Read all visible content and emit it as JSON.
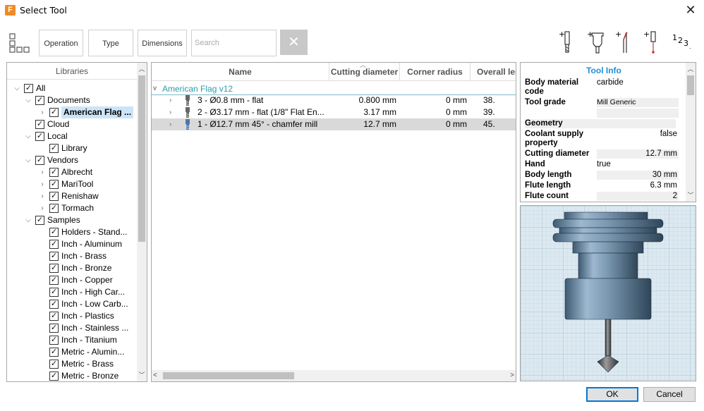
{
  "window": {
    "title": "Select Tool",
    "app_icon_letter": "F"
  },
  "toolbar": {
    "operation_label": "Operation",
    "type_label": "Type",
    "dimensions_label": "Dimensions",
    "search_placeholder": "Search",
    "clear_symbol": "✕",
    "numbering_label": "1 2 3"
  },
  "libraries": {
    "header": "Libraries",
    "items": [
      {
        "label": "All",
        "level": 0,
        "arrow": "v",
        "checked": true
      },
      {
        "label": "Documents",
        "level": 1,
        "arrow": "v",
        "checked": true
      },
      {
        "label": "American Flag ...",
        "level": 2,
        "arrow": ">",
        "checked": true,
        "selected": true
      },
      {
        "label": "Cloud",
        "level": 1,
        "arrow": "",
        "checked": true
      },
      {
        "label": "Local",
        "level": 1,
        "arrow": "v",
        "checked": true
      },
      {
        "label": "Library",
        "level": 2,
        "arrow": "",
        "checked": true
      },
      {
        "label": "Vendors",
        "level": 1,
        "arrow": "v",
        "checked": true
      },
      {
        "label": "Albrecht",
        "level": 2,
        "arrow": ">",
        "checked": true
      },
      {
        "label": "MariTool",
        "level": 2,
        "arrow": ">",
        "checked": true
      },
      {
        "label": "Renishaw",
        "level": 2,
        "arrow": ">",
        "checked": true
      },
      {
        "label": "Tormach",
        "level": 2,
        "arrow": ">",
        "checked": true
      },
      {
        "label": "Samples",
        "level": 1,
        "arrow": "v",
        "checked": true
      },
      {
        "label": "Holders - Stand...",
        "level": 2,
        "arrow": "",
        "checked": true
      },
      {
        "label": "Inch - Aluminum",
        "level": 2,
        "arrow": "",
        "checked": true
      },
      {
        "label": "Inch - Brass",
        "level": 2,
        "arrow": "",
        "checked": true
      },
      {
        "label": "Inch - Bronze",
        "level": 2,
        "arrow": "",
        "checked": true
      },
      {
        "label": "Inch - Copper",
        "level": 2,
        "arrow": "",
        "checked": true
      },
      {
        "label": "Inch - High Car...",
        "level": 2,
        "arrow": "",
        "checked": true
      },
      {
        "label": "Inch - Low Carb...",
        "level": 2,
        "arrow": "",
        "checked": true
      },
      {
        "label": "Inch - Plastics",
        "level": 2,
        "arrow": "",
        "checked": true
      },
      {
        "label": "Inch - Stainless ...",
        "level": 2,
        "arrow": "",
        "checked": true
      },
      {
        "label": "Inch - Titanium",
        "level": 2,
        "arrow": "",
        "checked": true
      },
      {
        "label": "Metric - Alumin...",
        "level": 2,
        "arrow": "",
        "checked": true
      },
      {
        "label": "Metric - Brass",
        "level": 2,
        "arrow": "",
        "checked": true
      },
      {
        "label": "Metric - Bronze",
        "level": 2,
        "arrow": "",
        "checked": true
      }
    ]
  },
  "tool_table": {
    "columns": [
      "Name",
      "Cutting diameter",
      "Corner radius",
      "Overall len"
    ],
    "group_label": "American Flag v12",
    "rows": [
      {
        "name": "3 - Ø0.8 mm - flat",
        "cutting_diameter": "0.800 mm",
        "corner_radius": "0 mm",
        "overall_length": "38.",
        "selected": false
      },
      {
        "name": "2 - Ø3.17 mm - flat (1/8\" Flat En...",
        "cutting_diameter": "3.17 mm",
        "corner_radius": "0 mm",
        "overall_length": "39.",
        "selected": false
      },
      {
        "name": "1 - Ø12.7 mm 45° - chamfer mill",
        "cutting_diameter": "12.7 mm",
        "corner_radius": "0 mm",
        "overall_length": "45.",
        "selected": true
      }
    ]
  },
  "tool_info": {
    "title": "Tool Info",
    "body_material_key": "Body material code",
    "body_material_val": "carbide",
    "tool_grade_key": "Tool grade",
    "tool_grade_val": "Mill Generic",
    "geometry_key": "Geometry",
    "coolant_key": "Coolant supply property",
    "coolant_val": "false",
    "cutting_diameter_key": "Cutting diameter",
    "cutting_diameter_val": "12.7 mm",
    "hand_key": "Hand",
    "hand_val": "true",
    "body_length_key": "Body length",
    "body_length_val": "30 mm",
    "flute_length_key": "Flute length",
    "flute_length_val": "6.3 mm",
    "flute_count_key": "Flute count",
    "flute_count_val": "2"
  },
  "buttons": {
    "ok": "OK",
    "cancel": "Cancel"
  },
  "colors": {
    "accent": "#1f8fd6",
    "group_text": "#2a9bb0",
    "selection": "#cce4f7",
    "tool_body": "#7a97b0"
  }
}
